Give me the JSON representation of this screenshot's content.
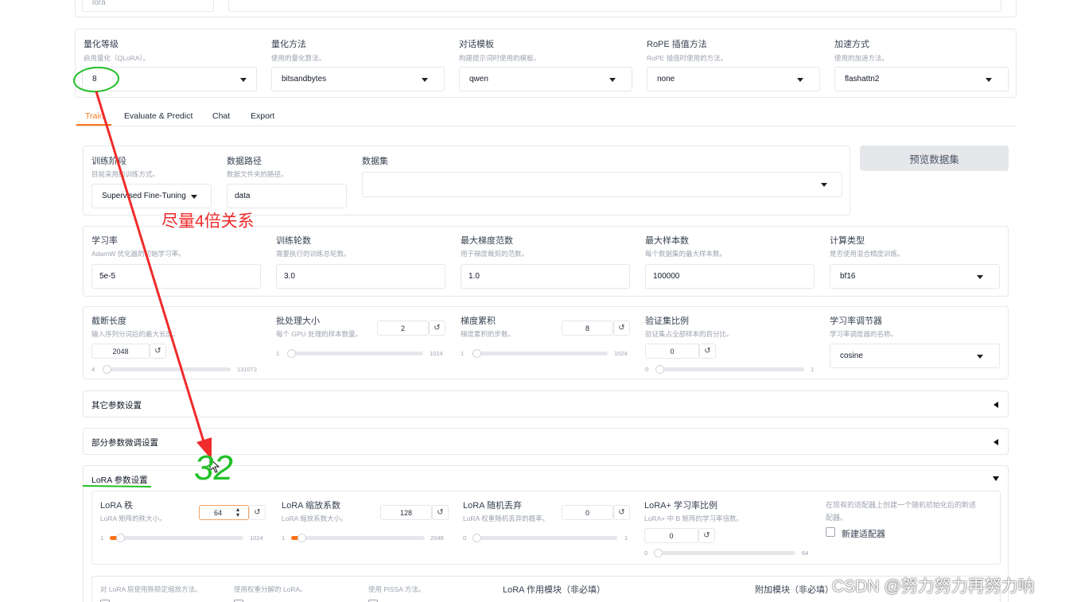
{
  "top_partial": {
    "value": "lora"
  },
  "quant_row": {
    "fields": [
      {
        "label": "量化等级",
        "info": "启用量化（QLoRA）。",
        "value": "8"
      },
      {
        "label": "量化方法",
        "info": "使用的量化算法。",
        "value": "bitsandbytes"
      },
      {
        "label": "对话模板",
        "info": "构建提示词时使用的模板。",
        "value": "qwen"
      },
      {
        "label": "RoPE 插值方法",
        "info": "RoPE 插值时使用的方法。",
        "value": "none"
      },
      {
        "label": "加速方式",
        "info": "使用的加速方法。",
        "value": "flashattn2"
      }
    ]
  },
  "tabs": [
    "Train",
    "Evaluate & Predict",
    "Chat",
    "Export"
  ],
  "train": {
    "stage": {
      "label": "训练阶段",
      "info": "目前采用的训练方式。",
      "value": "Supervised Fine-Tuning"
    },
    "dataset_dir": {
      "label": "数据路径",
      "info": "数据文件夹的路径。",
      "value": "data"
    },
    "dataset": {
      "label": "数据集",
      "value": ""
    },
    "preview_button": "预览数据集"
  },
  "params_row": {
    "fields": [
      {
        "label": "学习率",
        "info": "AdamW 优化器的初始学习率。",
        "value": "5e-5"
      },
      {
        "label": "训练轮数",
        "info": "需要执行的训练总轮数。",
        "value": "3.0"
      },
      {
        "label": "最大梯度范数",
        "info": "用于梯度裁剪的范数。",
        "value": "1.0"
      },
      {
        "label": "最大样本数",
        "info": "每个数据集的最大样本数。",
        "value": "100000"
      },
      {
        "label": "计算类型",
        "info": "是否使用混合精度训练。",
        "value": "bf16"
      }
    ]
  },
  "sliders_row": {
    "cutoff": {
      "label": "截断长度",
      "info": "输入序列分词后的最大长度。",
      "value": "2048",
      "min": "4",
      "max": "131072"
    },
    "batch": {
      "label": "批处理大小",
      "info": "每个 GPU 处理的样本数量。",
      "value": "2",
      "min": "1",
      "max": "1024"
    },
    "grad_acc": {
      "label": "梯度累积",
      "info": "梯度累积的步数。",
      "value": "8",
      "min": "1",
      "max": "1024"
    },
    "val_size": {
      "label": "验证集比例",
      "info": "验证集占全部样本的百分比。",
      "value": "0",
      "min": "0",
      "max": "1"
    },
    "scheduler": {
      "label": "学习率调节器",
      "info": "学习率调度器的名称。",
      "value": "cosine"
    }
  },
  "accordions": {
    "extra": "其它参数设置",
    "freeze": "部分参数微调设置",
    "lora": "LoRA 参数设置"
  },
  "lora": {
    "rank": {
      "label": "LoRA 秩",
      "info": "LoRA 矩阵的秩大小。",
      "value": "64",
      "min": "1",
      "max": "1024"
    },
    "alpha": {
      "label": "LoRA 缩放系数",
      "info": "LoRA 缩放系数大小。",
      "value": "128",
      "min": "1",
      "max": "2048"
    },
    "dropout": {
      "label": "LoRA 随机丢弃",
      "info": "LoRA 权重随机丢弃的概率。",
      "value": "0",
      "min": "0",
      "max": "1"
    },
    "plus_ratio": {
      "label": "LoRA+ 学习率比例",
      "info": "LoRA+ 中 B 矩阵的学习率倍数。",
      "value": "0",
      "min": "0",
      "max": "64"
    },
    "create_new_info_1": "在现有的适配器上创建一个随机初始化后的新适",
    "create_new_info_2": "配器。",
    "create_new_label": "新建适配器"
  },
  "bottom_row": {
    "rslora_info": "对 LoRA 层使用秩稳定缩放方法。",
    "dora_info": "使用权重分解的 LoRA。",
    "pissa_info": "使用 PiSSA 方法。",
    "target_label": "LoRA 作用模块（非必填）",
    "additional_label": "附加模块（非必填）"
  },
  "annotations": {
    "text": "尽量4倍关系",
    "handwritten": "32",
    "color_red": "#ef2b2b",
    "color_green": "#22c02a"
  },
  "watermark": "CSDN @努力努力再努力呐",
  "colors": {
    "accent": "#f97316",
    "border": "#e5e7eb"
  }
}
